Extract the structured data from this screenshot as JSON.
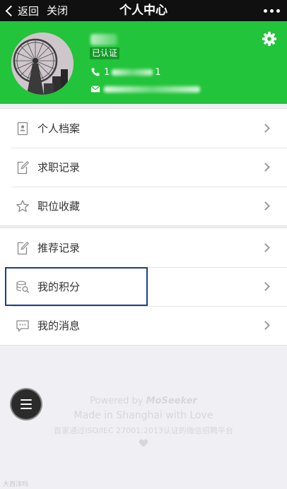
{
  "navbar": {
    "back_label": "返回",
    "close_label": "关闭",
    "title": "个人中心"
  },
  "profile": {
    "verified_badge": "已认证",
    "phone_prefix": "1",
    "phone_suffix": "1",
    "colors": {
      "header_green": "#21c43a",
      "badge_green": "#149a2a"
    }
  },
  "menu": {
    "group1": [
      {
        "label": "个人档案",
        "icon": "profile-card-icon"
      },
      {
        "label": "求职记录",
        "icon": "edit-note-icon"
      },
      {
        "label": "职位收藏",
        "icon": "star-icon"
      }
    ],
    "group2": [
      {
        "label": "推荐记录",
        "icon": "edit-note-icon"
      },
      {
        "label": "我的积分",
        "icon": "coins-search-icon"
      },
      {
        "label": "我的消息",
        "icon": "message-icon"
      }
    ]
  },
  "footer": {
    "powered_prefix": "Powered by",
    "powered_brand": "MoSeeker",
    "made_in": "Made in Shanghai with Love",
    "certification": "首家通过ISO/IEC 27001:2013认证的微信招聘平台"
  },
  "watermark": "大西洋吗"
}
